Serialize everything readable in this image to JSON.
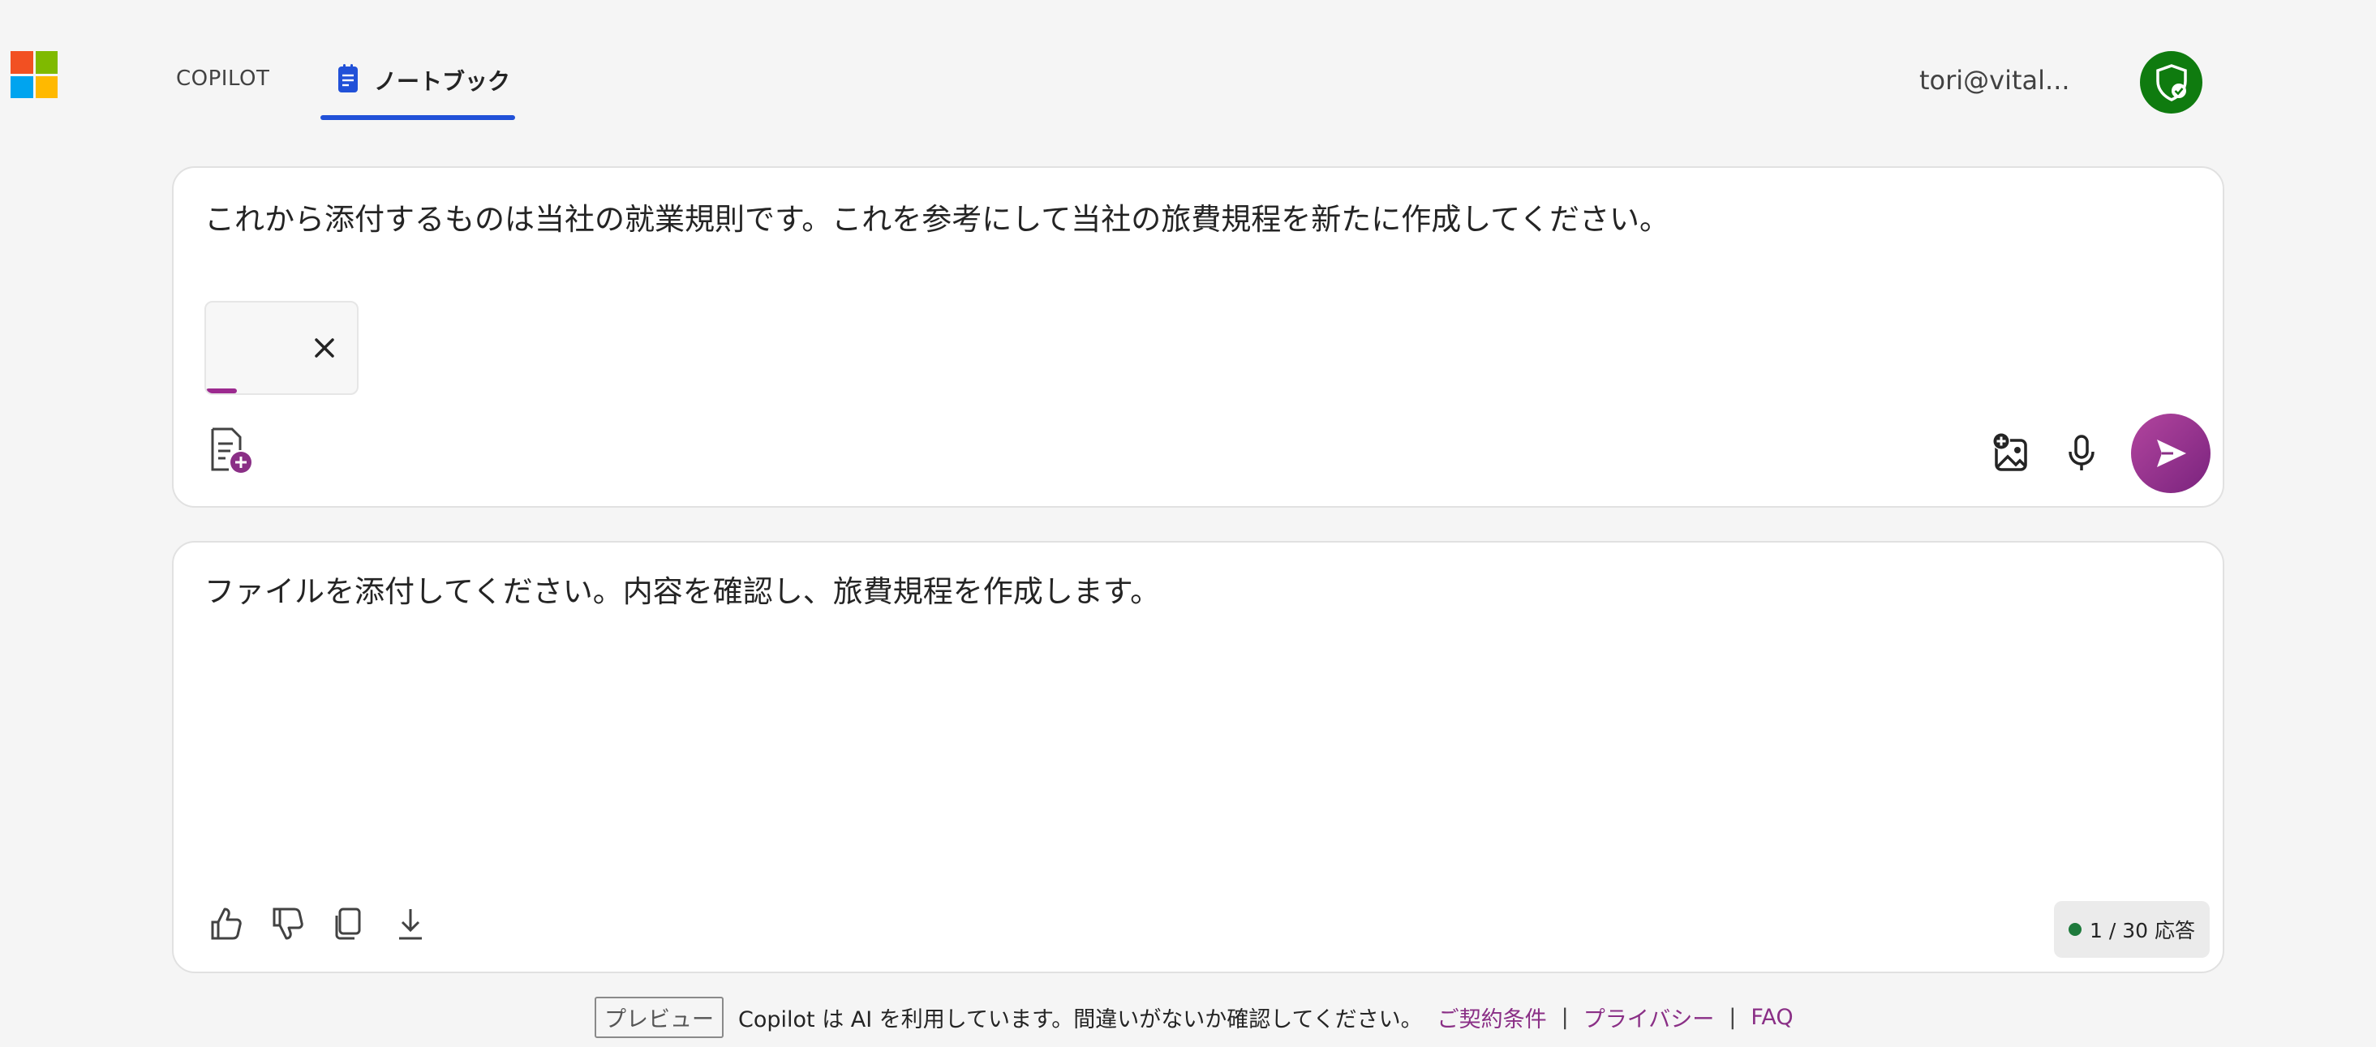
{
  "header": {
    "tabs": [
      {
        "label": "COPILOT"
      },
      {
        "label": "ノートブック",
        "active": true
      }
    ],
    "user_email": "tori@vital...",
    "icons": {
      "logo": "microsoft-logo",
      "notebook": "notebook-icon",
      "shield": "shield-check-icon"
    }
  },
  "prompt": {
    "text": "これから添付するものは当社の就業規則です。これを参考にして当社の旅費規程を新たに作成してください。",
    "attachment": {
      "progress": 0.2
    },
    "icons": [
      "add-document-icon",
      "add-image-icon",
      "microphone-icon",
      "send-icon"
    ]
  },
  "response": {
    "text": "ファイルを添付してください。内容を確認し、旅費規程を作成します。",
    "actions": [
      "thumbs-up-icon",
      "thumbs-down-icon",
      "copy-icon",
      "download-icon"
    ],
    "count": "1 / 30 応答"
  },
  "footer": {
    "preview": "プレビュー",
    "notice": "Copilot は AI を利用しています。間違いがないか確認してください。",
    "terms": "ご契約条件",
    "privacy": "プライバシー",
    "faq": "FAQ",
    "separator": "|"
  },
  "colors": {
    "accent_purple": "#9c2a8f",
    "tab_underline": "#2151d8",
    "shield_green": "#0f7b0f"
  }
}
